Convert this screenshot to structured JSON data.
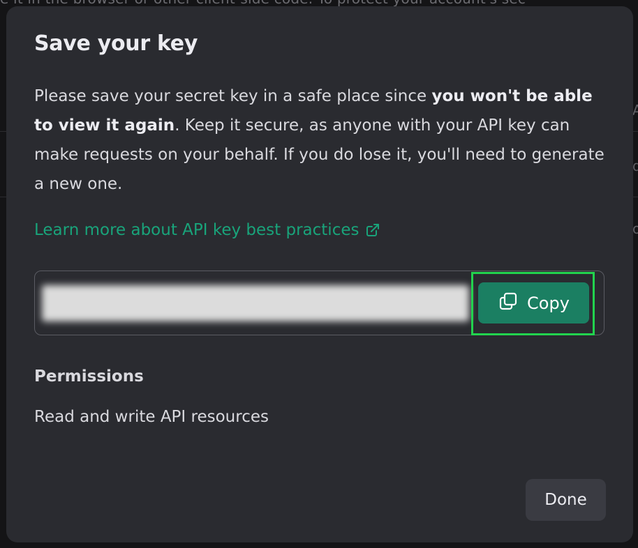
{
  "background": {
    "partial_text": "e it in the browser or other client-side code. To protect your account's sec"
  },
  "modal": {
    "title": "Save your key",
    "description": {
      "part1": "Please save your secret key in a safe place since ",
      "bold": "you won't be able to view it again",
      "part2": ". Keep it secure, as anyone with your API key can make requests on your behalf. If you do lose it, you'll need to generate a new one."
    },
    "learn_link": {
      "label": "Learn more about API key best practices",
      "icon": "external-link-icon"
    },
    "key_field": {
      "value_hidden": true
    },
    "copy_button": {
      "label": "Copy",
      "icon": "copy-icon"
    },
    "permissions": {
      "label": "Permissions",
      "value": "Read and write API resources"
    },
    "done_button": {
      "label": "Done"
    }
  },
  "colors": {
    "modal_bg": "#2a2b30",
    "accent_green": "#19a37a",
    "copy_button_bg": "#1b7f62",
    "highlight_frame": "#22d34e",
    "done_button_bg": "#3a3b42"
  }
}
